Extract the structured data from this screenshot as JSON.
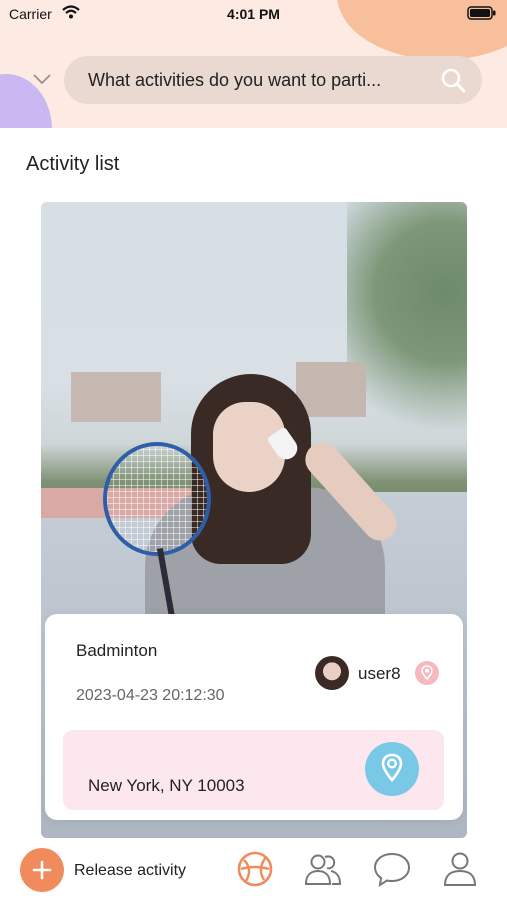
{
  "status_bar": {
    "carrier": "Carrier",
    "time": "4:01 PM"
  },
  "search": {
    "placeholder": "What activities do you want to parti..."
  },
  "section": {
    "title": "Activity list"
  },
  "activity": {
    "name": "Badminton",
    "datetime": "2023-04-23 20:12:30",
    "user": "user8",
    "address": "New York, NY 10003"
  },
  "bottom_bar": {
    "release_label": "Release activity",
    "tabs": [
      "activities-icon",
      "friends-icon",
      "chat-icon",
      "profile-icon"
    ]
  },
  "colors": {
    "header_bg": "#fdebe3",
    "accent_orange": "#f08b5d",
    "location_blue": "#78c8e6",
    "address_bg": "#fce7ee"
  }
}
